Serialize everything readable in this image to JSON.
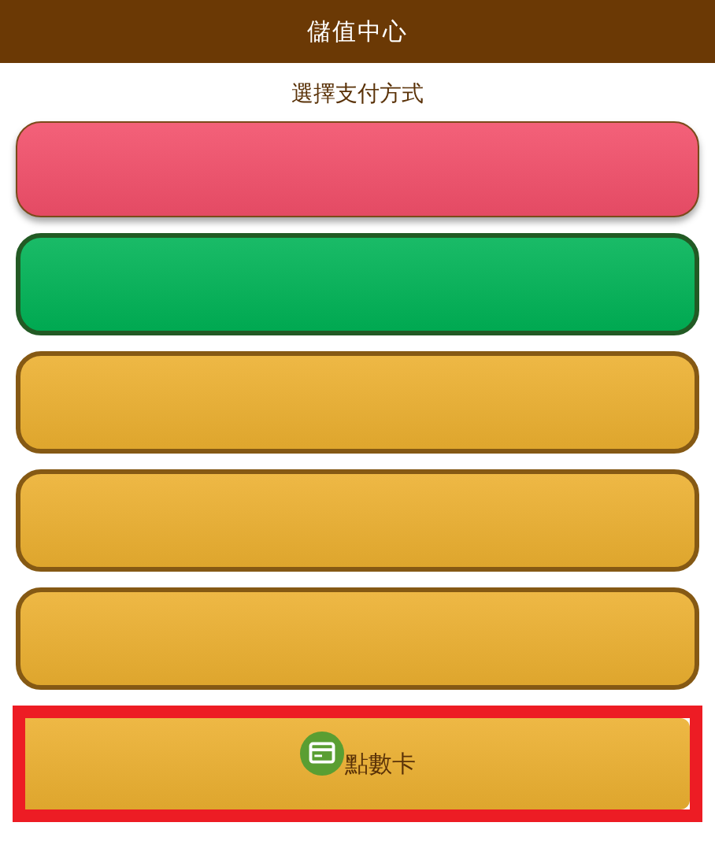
{
  "header": {
    "title": "儲值中心"
  },
  "subtitle": "選擇支付方式",
  "options": [
    {
      "kind": "raised",
      "color": "#f24f6a",
      "selected": false
    },
    {
      "kind": "outlined",
      "color": "#00b356",
      "selected": false
    },
    {
      "kind": "outlined",
      "color": "#ecb030",
      "selected": false
    },
    {
      "kind": "outlined",
      "color": "#ecb030",
      "selected": false
    },
    {
      "kind": "outlined",
      "color": "#ecb030",
      "selected": false
    },
    {
      "kind": "flat",
      "color": "#ecb030",
      "selected": true,
      "label": "點數卡",
      "icon": true
    }
  ]
}
